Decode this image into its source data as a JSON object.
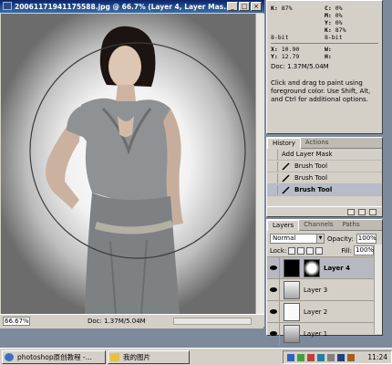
{
  "document": {
    "title": "20061171941175588.jpg @ 66.7% (Layer 4, Layer Mas...",
    "zoom": "66.67%",
    "doc_info": "Doc: 1.37M/5.04M"
  },
  "info_panel": {
    "k_label": "K:",
    "k_value": "87%",
    "bits_left": "8-bit",
    "c_label": "C:",
    "c_value": "0%",
    "m_label": "M:",
    "m_value": "0%",
    "y_label": "Y:",
    "y_value": "0%",
    "k2_label": "K:",
    "k2_value": "87%",
    "bits_right": "8-bit",
    "x_label": "X:",
    "x_value": "10.90",
    "y2_label": "Y:",
    "y2_value": "12.79",
    "w_label": "W:",
    "h_label": "H:",
    "doc_info": "Doc: 1.37M/5.04M",
    "hint": "Click and drag to paint using foreground color. Use Shift, Alt, and Ctrl for additional options."
  },
  "history_panel": {
    "tabs": [
      "History",
      "Actions"
    ],
    "items": [
      "Add Layer Mask",
      "Brush Tool",
      "Brush Tool",
      "Brush Tool"
    ]
  },
  "layers_panel": {
    "tabs": [
      "Layers",
      "Channels",
      "Paths"
    ],
    "blend_mode": "Normal",
    "opacity_label": "Opacity:",
    "opacity_value": "100%",
    "lock_label": "Lock:",
    "fill_label": "Fill:",
    "fill_value": "100%",
    "layers": [
      "Layer 4",
      "Layer 3",
      "Layer 2",
      "Layer 1"
    ]
  },
  "taskbar": {
    "tasks": [
      "photoshop原创教程 -...",
      "我的图片"
    ],
    "clock": "11:24"
  },
  "colors": {
    "title_bar": "#0a246a",
    "panel_bg": "#d4d0c8",
    "selection": "#b8b8c0"
  }
}
